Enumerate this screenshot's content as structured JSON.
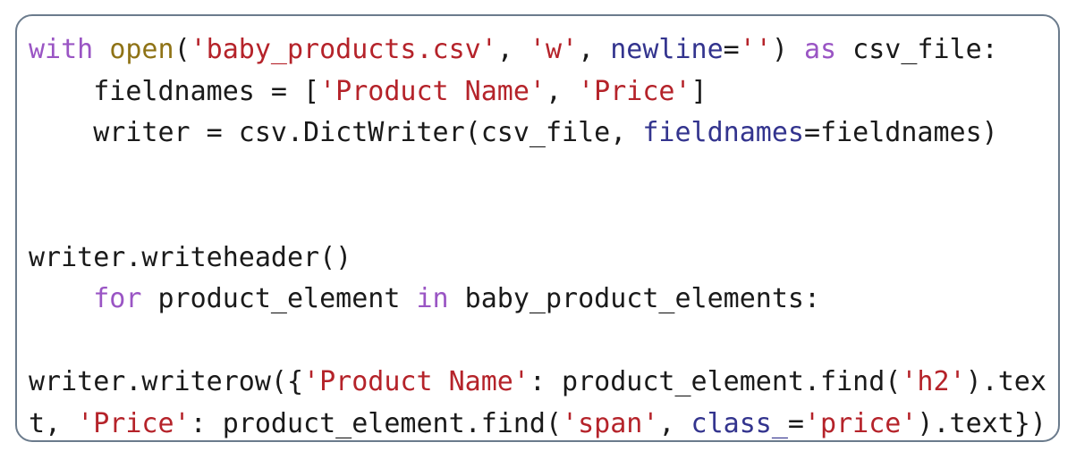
{
  "card": {
    "border_color": "#6b7b8c",
    "background_color": "#ffffff"
  },
  "theme": {
    "keyword_color": "#9a55c4",
    "builtin_color": "#8f7316",
    "string_color": "#b5232a",
    "kwarg_color": "#33348e",
    "plain_color": "#1a1a1a"
  },
  "code": {
    "language": "python",
    "plain_text": "with open('baby_products.csv', 'w', newline='') as csv_file:\n    fieldnames = ['Product Name', 'Price']\n    writer = csv.DictWriter(csv_file, fieldnames=fieldnames)\n\n\nwriter.writeheader()\n    for product_element in baby_product_elements:\n\nwriter.writerow({'Product Name': product_element.find('h2').tex\nt, 'Price': product_element.find('span', class_='price').text})",
    "lines": [
      {
        "index": 1,
        "tokens": [
          {
            "text": "with",
            "type": "keyword"
          },
          {
            "text": " ",
            "type": "plain"
          },
          {
            "text": "open",
            "type": "builtin"
          },
          {
            "text": "(",
            "type": "plain"
          },
          {
            "text": "'baby_products.csv'",
            "type": "string"
          },
          {
            "text": ", ",
            "type": "plain"
          },
          {
            "text": "'w'",
            "type": "string"
          },
          {
            "text": ", ",
            "type": "plain"
          },
          {
            "text": "newline",
            "type": "kwarg"
          },
          {
            "text": "=",
            "type": "plain"
          },
          {
            "text": "''",
            "type": "string"
          },
          {
            "text": ") ",
            "type": "plain"
          },
          {
            "text": "as",
            "type": "keyword"
          },
          {
            "text": " csv_file:",
            "type": "plain"
          }
        ]
      },
      {
        "index": 2,
        "tokens": [
          {
            "text": "    fieldnames = [",
            "type": "plain"
          },
          {
            "text": "'Product Name'",
            "type": "string"
          },
          {
            "text": ", ",
            "type": "plain"
          },
          {
            "text": "'Price'",
            "type": "string"
          },
          {
            "text": "]",
            "type": "plain"
          }
        ]
      },
      {
        "index": 3,
        "tokens": [
          {
            "text": "    writer = csv.DictWriter(csv_file, ",
            "type": "plain"
          },
          {
            "text": "fieldnames",
            "type": "kwarg"
          },
          {
            "text": "=fieldnames)",
            "type": "plain"
          }
        ]
      },
      {
        "index": 4,
        "tokens": []
      },
      {
        "index": 5,
        "tokens": []
      },
      {
        "index": 6,
        "tokens": [
          {
            "text": "writer.writeheader()",
            "type": "plain"
          }
        ]
      },
      {
        "index": 7,
        "tokens": [
          {
            "text": "    ",
            "type": "plain"
          },
          {
            "text": "for",
            "type": "keyword"
          },
          {
            "text": " product_element ",
            "type": "plain"
          },
          {
            "text": "in",
            "type": "keyword"
          },
          {
            "text": " baby_product_elements:",
            "type": "plain"
          }
        ]
      },
      {
        "index": 8,
        "tokens": []
      },
      {
        "index": 9,
        "tokens": [
          {
            "text": "writer.writerow({",
            "type": "plain"
          },
          {
            "text": "'Product Name'",
            "type": "string"
          },
          {
            "text": ": product_element.find(",
            "type": "plain"
          },
          {
            "text": "'h2'",
            "type": "string"
          },
          {
            "text": ").tex",
            "type": "plain"
          }
        ]
      },
      {
        "index": 10,
        "tokens": [
          {
            "text": "t, ",
            "type": "plain"
          },
          {
            "text": "'Price'",
            "type": "string"
          },
          {
            "text": ": product_element.find(",
            "type": "plain"
          },
          {
            "text": "'span'",
            "type": "string"
          },
          {
            "text": ", ",
            "type": "plain"
          },
          {
            "text": "class_",
            "type": "kwarg"
          },
          {
            "text": "=",
            "type": "plain"
          },
          {
            "text": "'price'",
            "type": "string"
          },
          {
            "text": ").text})",
            "type": "plain"
          }
        ]
      }
    ]
  }
}
